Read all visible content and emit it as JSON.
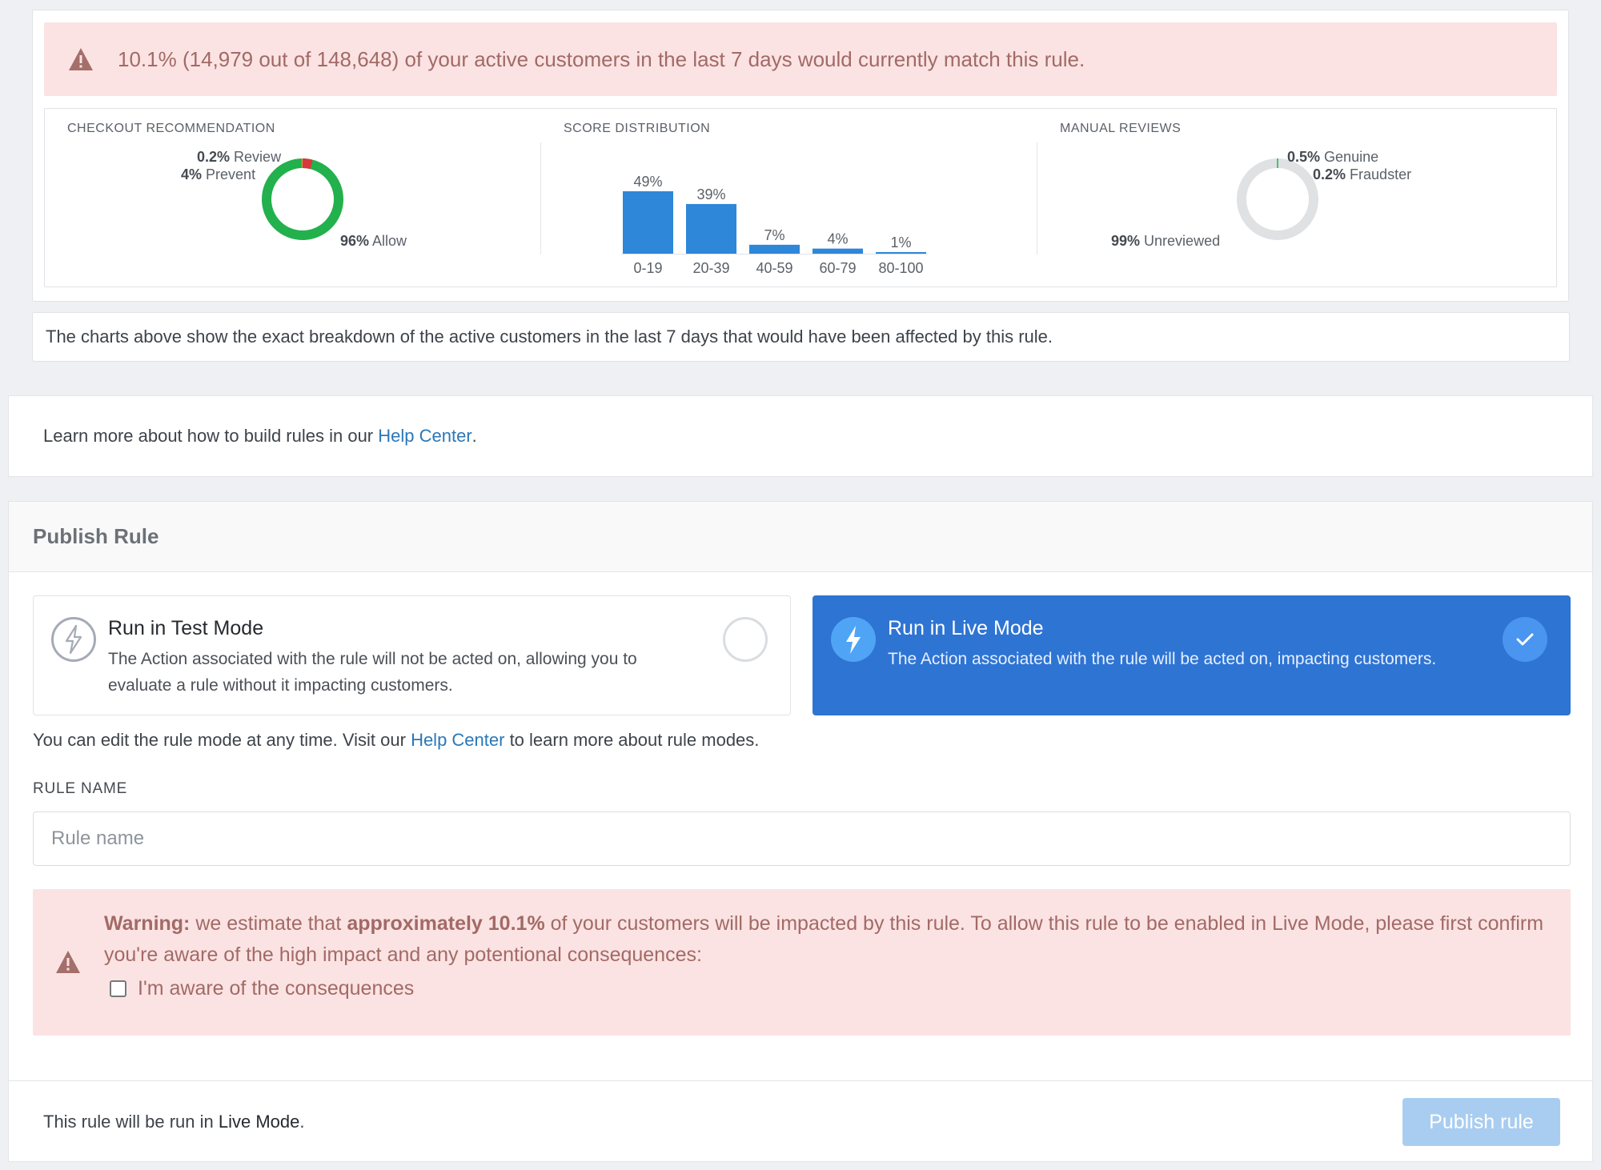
{
  "match_banner": {
    "icon": "warning-triangle-icon",
    "text": "10.1% (14,979 out of 148,648) of your active customers in the last 7 days would currently match this rule."
  },
  "checkout_recommendation": {
    "title": "CHECKOUT RECOMMENDATION",
    "review_pct": "0.2%",
    "review_label": "Review",
    "prevent_pct": "4%",
    "prevent_label": "Prevent",
    "allow_pct": "96%",
    "allow_label": "Allow",
    "colors": {
      "allow": "#22b14c",
      "prevent": "#d9363e",
      "review": "#f0ad4e"
    }
  },
  "score_distribution": {
    "title": "SCORE DISTRIBUTION",
    "bar_color": "#2e87d8"
  },
  "manual_reviews": {
    "title": "MANUAL REVIEWS",
    "genuine_pct": "0.5%",
    "genuine_label": "Genuine",
    "fraudster_pct": "0.2%",
    "fraudster_label": "Fraudster",
    "unreviewed_pct": "99%",
    "unreviewed_label": "Unreviewed",
    "colors": {
      "unreviewed": "#dfe1e3",
      "genuine": "#22b14c",
      "fraudster": "#d9363e"
    }
  },
  "chart_data": [
    {
      "type": "pie",
      "title": "CHECKOUT RECOMMENDATION",
      "categories": [
        "Allow",
        "Prevent",
        "Review"
      ],
      "values": [
        96,
        4,
        0.2
      ]
    },
    {
      "type": "bar",
      "title": "SCORE DISTRIBUTION",
      "categories": [
        "0-19",
        "20-39",
        "40-59",
        "60-79",
        "80-100"
      ],
      "values": [
        49,
        39,
        7,
        4,
        1
      ],
      "labels": [
        "49%",
        "39%",
        "7%",
        "4%",
        "1%"
      ],
      "ylim": [
        0,
        49
      ]
    },
    {
      "type": "pie",
      "title": "MANUAL REVIEWS",
      "categories": [
        "Unreviewed",
        "Genuine",
        "Fraudster"
      ],
      "values": [
        99,
        0.5,
        0.2
      ]
    }
  ],
  "info_note": "The charts above show the exact breakdown of the active customers in the last 7 days that would have been affected by this rule.",
  "learn_more": {
    "prefix": "Learn more about how to build rules in our ",
    "link": "Help Center",
    "suffix": "."
  },
  "publish": {
    "title": "Publish Rule",
    "test_mode": {
      "icon": "lightning-bolt-icon",
      "title": "Run in Test Mode",
      "description": "The Action associated with the rule will not be acted on, allowing you to evaluate a rule without it impacting customers.",
      "selected": false
    },
    "live_mode": {
      "icon": "lightning-bolt-icon",
      "title": "Run in Live Mode",
      "description": "The Action associated with the rule will be acted on, impacting customers.",
      "selected": true,
      "check_icon": "checkmark-icon"
    },
    "hint_prefix": "You can edit the rule mode at any time. Visit our ",
    "hint_link": "Help Center",
    "hint_suffix": " to learn more about rule modes.",
    "rule_name_label": "RULE NAME",
    "rule_name_placeholder": "Rule name",
    "rule_name_value": "",
    "warning": {
      "icon": "warning-triangle-icon",
      "strong1": "Warning:",
      "text1": " we estimate that ",
      "strong2": "approximately 10.1%",
      "text2": " of your customers will be impacted by this rule. To allow this rule to be enabled in Live Mode, please first confirm you're aware of the high impact and any potentional consequences:",
      "ack_label": "I'm aware of the consequences",
      "ack_checked": false
    },
    "footer_prefix": "This rule will be run in ",
    "footer_mode": "Live Mode",
    "footer_suffix": ".",
    "publish_button": "Publish rule"
  }
}
